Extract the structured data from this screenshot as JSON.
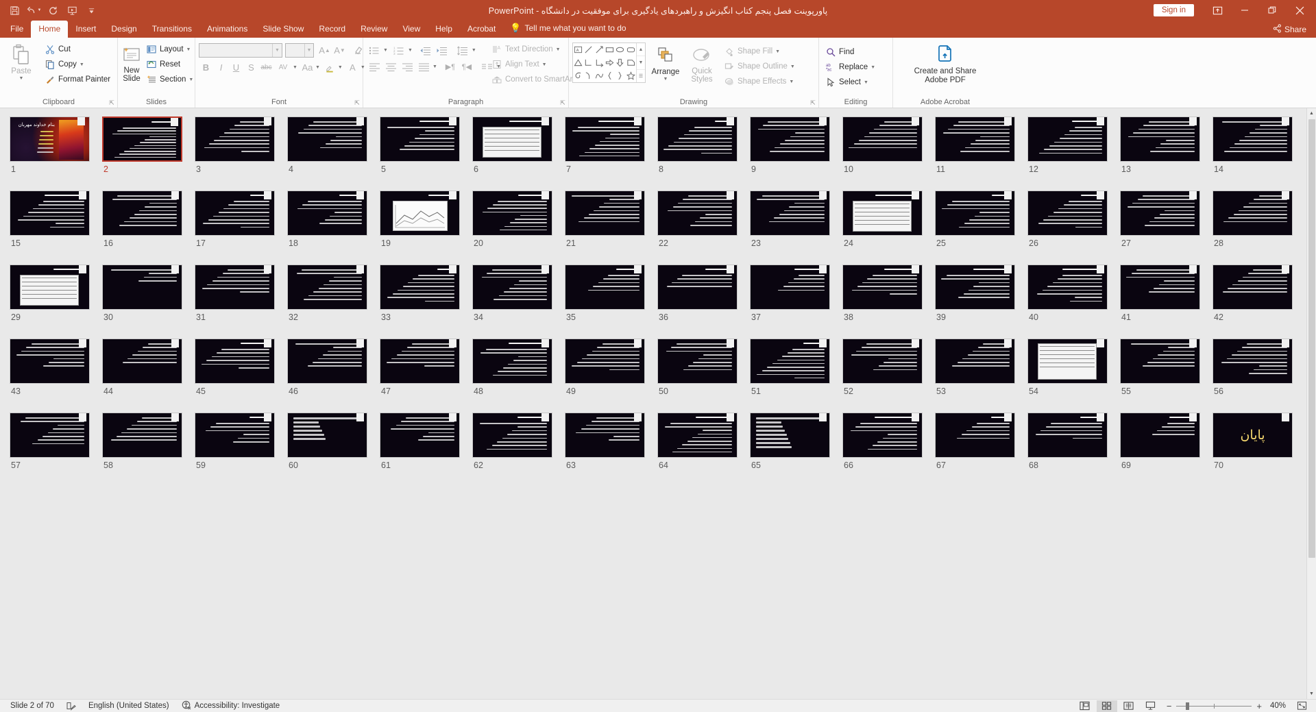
{
  "titlebar": {
    "title": "پاورپوینت فصل پنجم کتاب انگیزش و راهبردهای یادگیری برای موفقیت در دانشگاه  -  PowerPoint",
    "signin_label": "Sign in",
    "qat": [
      {
        "name": "save-icon",
        "label": "Save"
      },
      {
        "name": "undo-icon",
        "label": "Undo"
      },
      {
        "name": "redo-icon",
        "label": "Redo"
      },
      {
        "name": "start-presentation-icon",
        "label": "Start From Beginning"
      },
      {
        "name": "customize-qat-icon",
        "label": "Customize Quick Access Toolbar"
      }
    ],
    "window_buttons": [
      {
        "name": "ribbon-display-options-icon",
        "label": "Ribbon Display Options"
      },
      {
        "name": "minimize-icon",
        "label": "Minimize"
      },
      {
        "name": "restore-icon",
        "label": "Restore Down"
      },
      {
        "name": "close-icon",
        "label": "Close"
      }
    ]
  },
  "tabs": [
    {
      "label": "File",
      "active": false
    },
    {
      "label": "Home",
      "active": true
    },
    {
      "label": "Insert",
      "active": false
    },
    {
      "label": "Design",
      "active": false
    },
    {
      "label": "Transitions",
      "active": false
    },
    {
      "label": "Animations",
      "active": false
    },
    {
      "label": "Slide Show",
      "active": false
    },
    {
      "label": "Record",
      "active": false
    },
    {
      "label": "Review",
      "active": false
    },
    {
      "label": "View",
      "active": false
    },
    {
      "label": "Help",
      "active": false
    },
    {
      "label": "Acrobat",
      "active": false
    }
  ],
  "tellme": {
    "placeholder": "Tell me what you want to do"
  },
  "share": {
    "label": "Share"
  },
  "ribbon": {
    "clipboard": {
      "label": "Clipboard",
      "paste": "Paste",
      "cut": "Cut",
      "copy": "Copy",
      "format_painter": "Format Painter"
    },
    "slides": {
      "label": "Slides",
      "new_slide": "New\nSlide",
      "new_slide_line1": "New",
      "new_slide_line2": "Slide",
      "layout": "Layout",
      "reset": "Reset",
      "section": "Section"
    },
    "font": {
      "label": "Font",
      "font_name_value": "",
      "font_size_value": "",
      "bold": "B",
      "italic": "I",
      "underline": "U",
      "shadow": "S",
      "strikethrough": "abc",
      "char_spacing": "AV",
      "change_case": "Aa"
    },
    "paragraph": {
      "label": "Paragraph",
      "text_direction": "Text Direction",
      "align_text": "Align Text",
      "convert_to_smartart": "Convert to SmartArt"
    },
    "drawing": {
      "label": "Drawing",
      "arrange": "Arrange",
      "quick_styles_line1": "Quick",
      "quick_styles_line2": "Styles",
      "shape_fill": "Shape Fill",
      "shape_outline": "Shape Outline",
      "shape_effects": "Shape Effects"
    },
    "editing": {
      "label": "Editing",
      "find": "Find",
      "replace": "Replace",
      "select": "Select"
    },
    "acrobat": {
      "label": "Adobe Acrobat",
      "create_share_line1": "Create and Share",
      "create_share_line2": "Adobe PDF"
    }
  },
  "slides": {
    "total": 70,
    "selected": 2,
    "items": [
      {
        "n": 1,
        "kind": "title",
        "title": "بنام خداوند مهربان"
      },
      {
        "n": 2,
        "kind": "text",
        "lines": 11,
        "heading": true
      },
      {
        "n": 3,
        "kind": "text",
        "lines": 9,
        "heading": false
      },
      {
        "n": 4,
        "kind": "text",
        "lines": 8,
        "heading": false
      },
      {
        "n": 5,
        "kind": "text",
        "lines": 7,
        "heading": true
      },
      {
        "n": 6,
        "kind": "table",
        "lines": 3,
        "heading": true
      },
      {
        "n": 7,
        "kind": "text",
        "lines": 9,
        "heading": true
      },
      {
        "n": 8,
        "kind": "text",
        "lines": 8,
        "heading": true
      },
      {
        "n": 9,
        "kind": "text",
        "lines": 9,
        "heading": false
      },
      {
        "n": 10,
        "kind": "text",
        "lines": 8,
        "heading": false
      },
      {
        "n": 11,
        "kind": "text",
        "lines": 9,
        "heading": false
      },
      {
        "n": 12,
        "kind": "text",
        "lines": 8,
        "heading": true
      },
      {
        "n": 13,
        "kind": "text",
        "lines": 9,
        "heading": false
      },
      {
        "n": 14,
        "kind": "text",
        "lines": 9,
        "heading": false
      },
      {
        "n": 15,
        "kind": "text",
        "lines": 8,
        "heading": true
      },
      {
        "n": 16,
        "kind": "text",
        "lines": 9,
        "heading": false
      },
      {
        "n": 17,
        "kind": "text",
        "lines": 8,
        "heading": true
      },
      {
        "n": 18,
        "kind": "text",
        "lines": 7,
        "heading": true
      },
      {
        "n": 19,
        "kind": "chart",
        "lines": 2,
        "heading": true
      },
      {
        "n": 20,
        "kind": "text",
        "lines": 9,
        "heading": true
      },
      {
        "n": 21,
        "kind": "text",
        "lines": 8,
        "heading": false
      },
      {
        "n": 22,
        "kind": "text",
        "lines": 9,
        "heading": false
      },
      {
        "n": 23,
        "kind": "text",
        "lines": 8,
        "heading": false
      },
      {
        "n": 24,
        "kind": "table",
        "lines": 2,
        "heading": true
      },
      {
        "n": 25,
        "kind": "text",
        "lines": 8,
        "heading": true
      },
      {
        "n": 26,
        "kind": "text",
        "lines": 8,
        "heading": true
      },
      {
        "n": 27,
        "kind": "text",
        "lines": 9,
        "heading": false
      },
      {
        "n": 28,
        "kind": "text",
        "lines": 8,
        "heading": false
      },
      {
        "n": 29,
        "kind": "table",
        "lines": 2,
        "heading": true
      },
      {
        "n": 30,
        "kind": "text",
        "lines": 4,
        "heading": false
      },
      {
        "n": 31,
        "kind": "text",
        "lines": 7,
        "heading": false
      },
      {
        "n": 32,
        "kind": "text",
        "lines": 9,
        "heading": false
      },
      {
        "n": 33,
        "kind": "text",
        "lines": 8,
        "heading": true
      },
      {
        "n": 34,
        "kind": "text",
        "lines": 9,
        "heading": false
      },
      {
        "n": 35,
        "kind": "text",
        "lines": 5,
        "heading": true
      },
      {
        "n": 36,
        "kind": "text",
        "lines": 4,
        "heading": true
      },
      {
        "n": 37,
        "kind": "text",
        "lines": 5,
        "heading": true
      },
      {
        "n": 38,
        "kind": "text",
        "lines": 6,
        "heading": true
      },
      {
        "n": 39,
        "kind": "text",
        "lines": 7,
        "heading": true
      },
      {
        "n": 40,
        "kind": "text",
        "lines": 8,
        "heading": true
      },
      {
        "n": 41,
        "kind": "text",
        "lines": 7,
        "heading": false
      },
      {
        "n": 42,
        "kind": "text",
        "lines": 7,
        "heading": false
      },
      {
        "n": 43,
        "kind": "text",
        "lines": 7,
        "heading": false
      },
      {
        "n": 44,
        "kind": "text",
        "lines": 6,
        "heading": false
      },
      {
        "n": 45,
        "kind": "text",
        "lines": 6,
        "heading": true
      },
      {
        "n": 46,
        "kind": "text",
        "lines": 7,
        "heading": false
      },
      {
        "n": 47,
        "kind": "text",
        "lines": 7,
        "heading": false
      },
      {
        "n": 48,
        "kind": "text",
        "lines": 8,
        "heading": true
      },
      {
        "n": 49,
        "kind": "text",
        "lines": 8,
        "heading": false
      },
      {
        "n": 50,
        "kind": "text",
        "lines": 8,
        "heading": false
      },
      {
        "n": 51,
        "kind": "text",
        "lines": 9,
        "heading": true
      },
      {
        "n": 52,
        "kind": "text",
        "lines": 8,
        "heading": false
      },
      {
        "n": 53,
        "kind": "text",
        "lines": 7,
        "heading": false
      },
      {
        "n": 54,
        "kind": "table",
        "lines": 2,
        "heading": false
      },
      {
        "n": 55,
        "kind": "text",
        "lines": 7,
        "heading": false
      },
      {
        "n": 56,
        "kind": "text",
        "lines": 9,
        "heading": false
      },
      {
        "n": 57,
        "kind": "text",
        "lines": 8,
        "heading": false
      },
      {
        "n": 58,
        "kind": "text",
        "lines": 7,
        "heading": false
      },
      {
        "n": 59,
        "kind": "text",
        "lines": 6,
        "heading": true
      },
      {
        "n": 60,
        "kind": "bars",
        "lines": 6,
        "heading": false
      },
      {
        "n": 61,
        "kind": "text",
        "lines": 7,
        "heading": false
      },
      {
        "n": 62,
        "kind": "text",
        "lines": 8,
        "heading": true
      },
      {
        "n": 63,
        "kind": "text",
        "lines": 7,
        "heading": false
      },
      {
        "n": 64,
        "kind": "text",
        "lines": 9,
        "heading": true
      },
      {
        "n": 65,
        "kind": "bars",
        "lines": 8,
        "heading": false
      },
      {
        "n": 66,
        "kind": "text",
        "lines": 8,
        "heading": true
      },
      {
        "n": 67,
        "kind": "text",
        "lines": 5,
        "heading": true
      },
      {
        "n": 68,
        "kind": "text",
        "lines": 5,
        "heading": true
      },
      {
        "n": 69,
        "kind": "text",
        "lines": 4,
        "heading": true
      },
      {
        "n": 70,
        "kind": "end",
        "title": "پایان"
      }
    ]
  },
  "statusbar": {
    "slide_position": "Slide 2 of 70",
    "language": "English (United States)",
    "accessibility": "Accessibility: Investigate",
    "zoom_level": "40%",
    "views": [
      {
        "name": "normal-view-button",
        "label": "Normal",
        "active": false
      },
      {
        "name": "slide-sorter-view-button",
        "label": "Slide Sorter",
        "active": true
      },
      {
        "name": "reading-view-button",
        "label": "Reading View",
        "active": false
      },
      {
        "name": "slide-show-button",
        "label": "Slide Show",
        "active": false
      }
    ]
  }
}
